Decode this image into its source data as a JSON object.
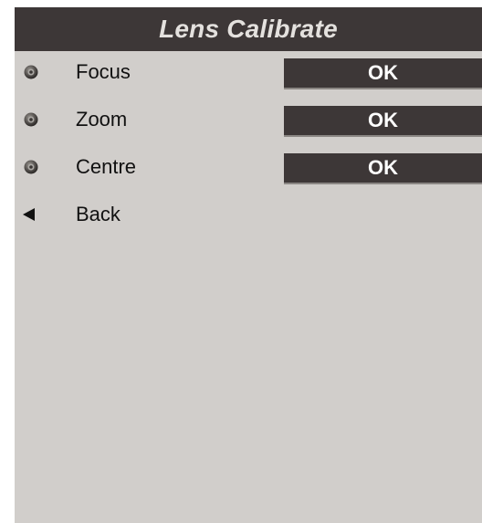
{
  "title": "Lens Calibrate",
  "menu": {
    "items": [
      {
        "label": "Focus",
        "value": "OK",
        "icon": "lens-icon"
      },
      {
        "label": "Zoom",
        "value": "OK",
        "icon": "lens-icon"
      },
      {
        "label": "Centre",
        "value": "OK",
        "icon": "lens-icon"
      }
    ],
    "back": {
      "label": "Back",
      "icon": "back-arrow-icon"
    }
  },
  "colors": {
    "background": "#d1cecb",
    "title_bar": "#3d3737",
    "title_text": "#e4e1de",
    "value_button": "#3d3737",
    "value_text": "#ffffff"
  }
}
